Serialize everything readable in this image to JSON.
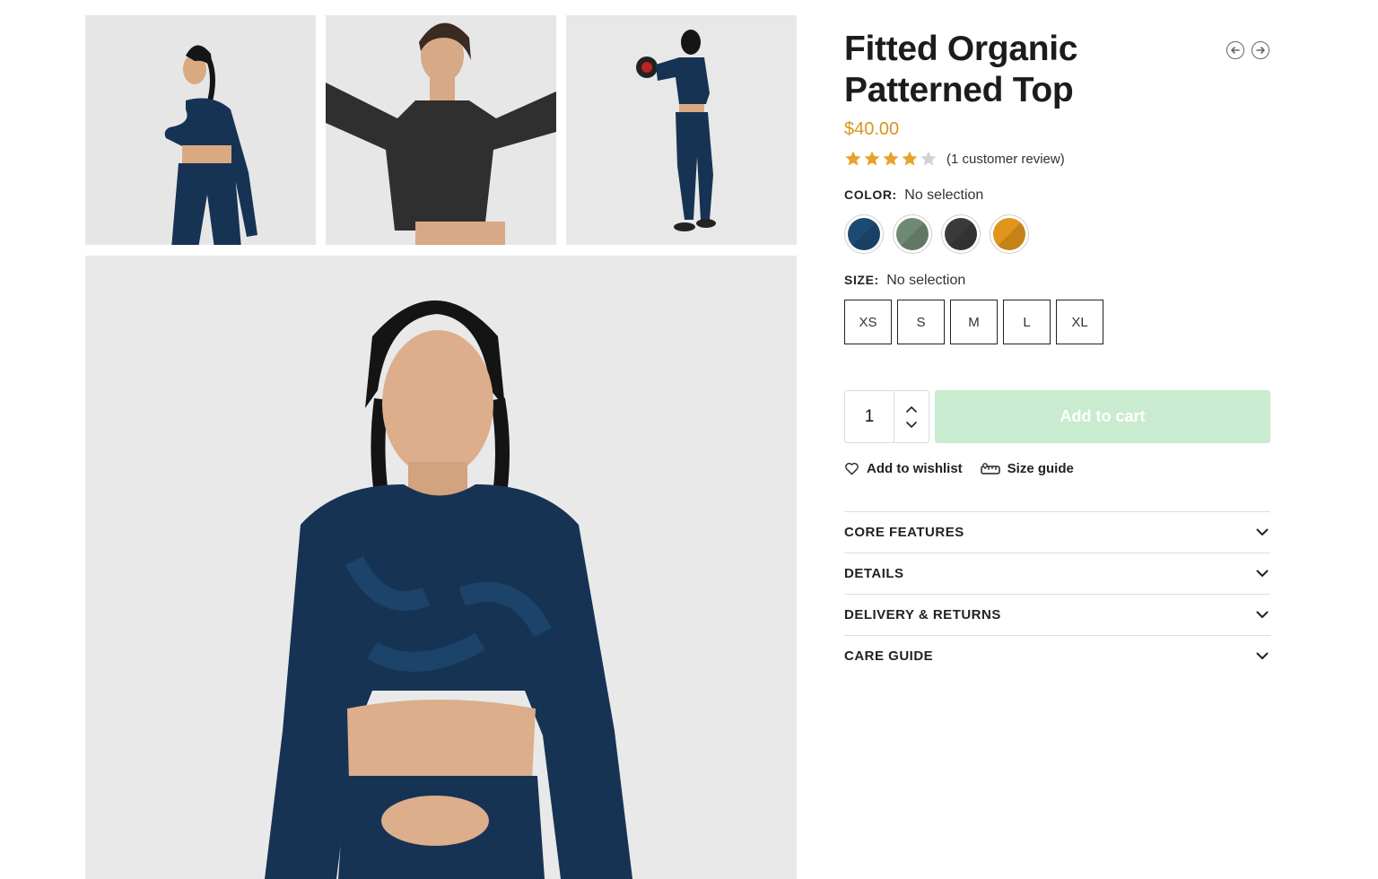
{
  "product": {
    "title": "Fitted Organic Patterned Top",
    "price": "$40.00",
    "rating": 4,
    "rating_max": 5,
    "review_text": "(1 customer review)"
  },
  "colors": {
    "accent_price": "#d9951b",
    "star_filled": "#e8a32a",
    "star_empty": "#d3d3d3",
    "cart_button_bg": "#c9ebcf"
  },
  "color_option": {
    "label": "COLOR:",
    "value": "No selection",
    "swatches": [
      {
        "name": "blue",
        "color": "#1c4a73"
      },
      {
        "name": "green-grey",
        "color": "#6f8a72"
      },
      {
        "name": "charcoal",
        "color": "#3a3a3a"
      },
      {
        "name": "orange",
        "color": "#e0951c"
      }
    ]
  },
  "size_option": {
    "label": "SIZE:",
    "value": "No selection",
    "sizes": [
      "XS",
      "S",
      "M",
      "L",
      "XL"
    ]
  },
  "purchase": {
    "quantity": "1",
    "add_to_cart": "Add to cart"
  },
  "links": {
    "wishlist": "Add to wishlist",
    "size_guide": "Size guide"
  },
  "accordion": [
    "CORE FEATURES",
    "DETAILS",
    "DELIVERY & RETURNS",
    "CARE GUIDE"
  ]
}
